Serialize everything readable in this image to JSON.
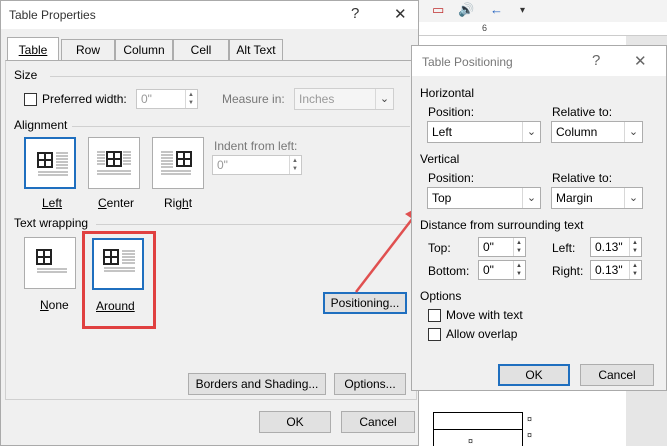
{
  "background": {
    "ruler_mark": "6"
  },
  "table_properties": {
    "title": "Table Properties",
    "help": "?",
    "close": "✕",
    "tabs": [
      "Table",
      "Row",
      "Column",
      "Cell",
      "Alt Text"
    ],
    "size": {
      "heading": "Size",
      "preferred_width_label": "Preferred width:",
      "preferred_width_value": "0\"",
      "measure_in_label": "Measure in:",
      "measure_in_value": "Inches"
    },
    "alignment": {
      "heading": "Alignment",
      "options": [
        "Left",
        "Center",
        "Right"
      ],
      "selected": "Left",
      "indent_label": "Indent from left:",
      "indent_value": "0\""
    },
    "text_wrapping": {
      "heading": "Text wrapping",
      "options": [
        "None",
        "Around"
      ],
      "selected": "Around"
    },
    "positioning_button": "Positioning...",
    "borders_button": "Borders and Shading...",
    "options_button": "Options...",
    "ok_button": "OK",
    "cancel_button": "Cancel"
  },
  "table_positioning": {
    "title": "Table Positioning",
    "help": "?",
    "close": "✕",
    "horizontal": {
      "heading": "Horizontal",
      "position_label": "Position:",
      "position_value": "Left",
      "relative_label": "Relative to:",
      "relative_value": "Column"
    },
    "vertical": {
      "heading": "Vertical",
      "position_label": "Position:",
      "position_value": "Top",
      "relative_label": "Relative to:",
      "relative_value": "Margin"
    },
    "distance": {
      "heading": "Distance from surrounding text",
      "top_label": "Top:",
      "top_value": "0\"",
      "bottom_label": "Bottom:",
      "bottom_value": "0\"",
      "left_label": "Left:",
      "left_value": "0.13\"",
      "right_label": "Right:",
      "right_value": "0.13\""
    },
    "options": {
      "heading": "Options",
      "move_with_text": "Move with text",
      "allow_overlap": "Allow overlap"
    },
    "ok_button": "OK",
    "cancel_button": "Cancel"
  },
  "colors": {
    "accent": "#1f6fbf",
    "annotation": "#e04040"
  }
}
